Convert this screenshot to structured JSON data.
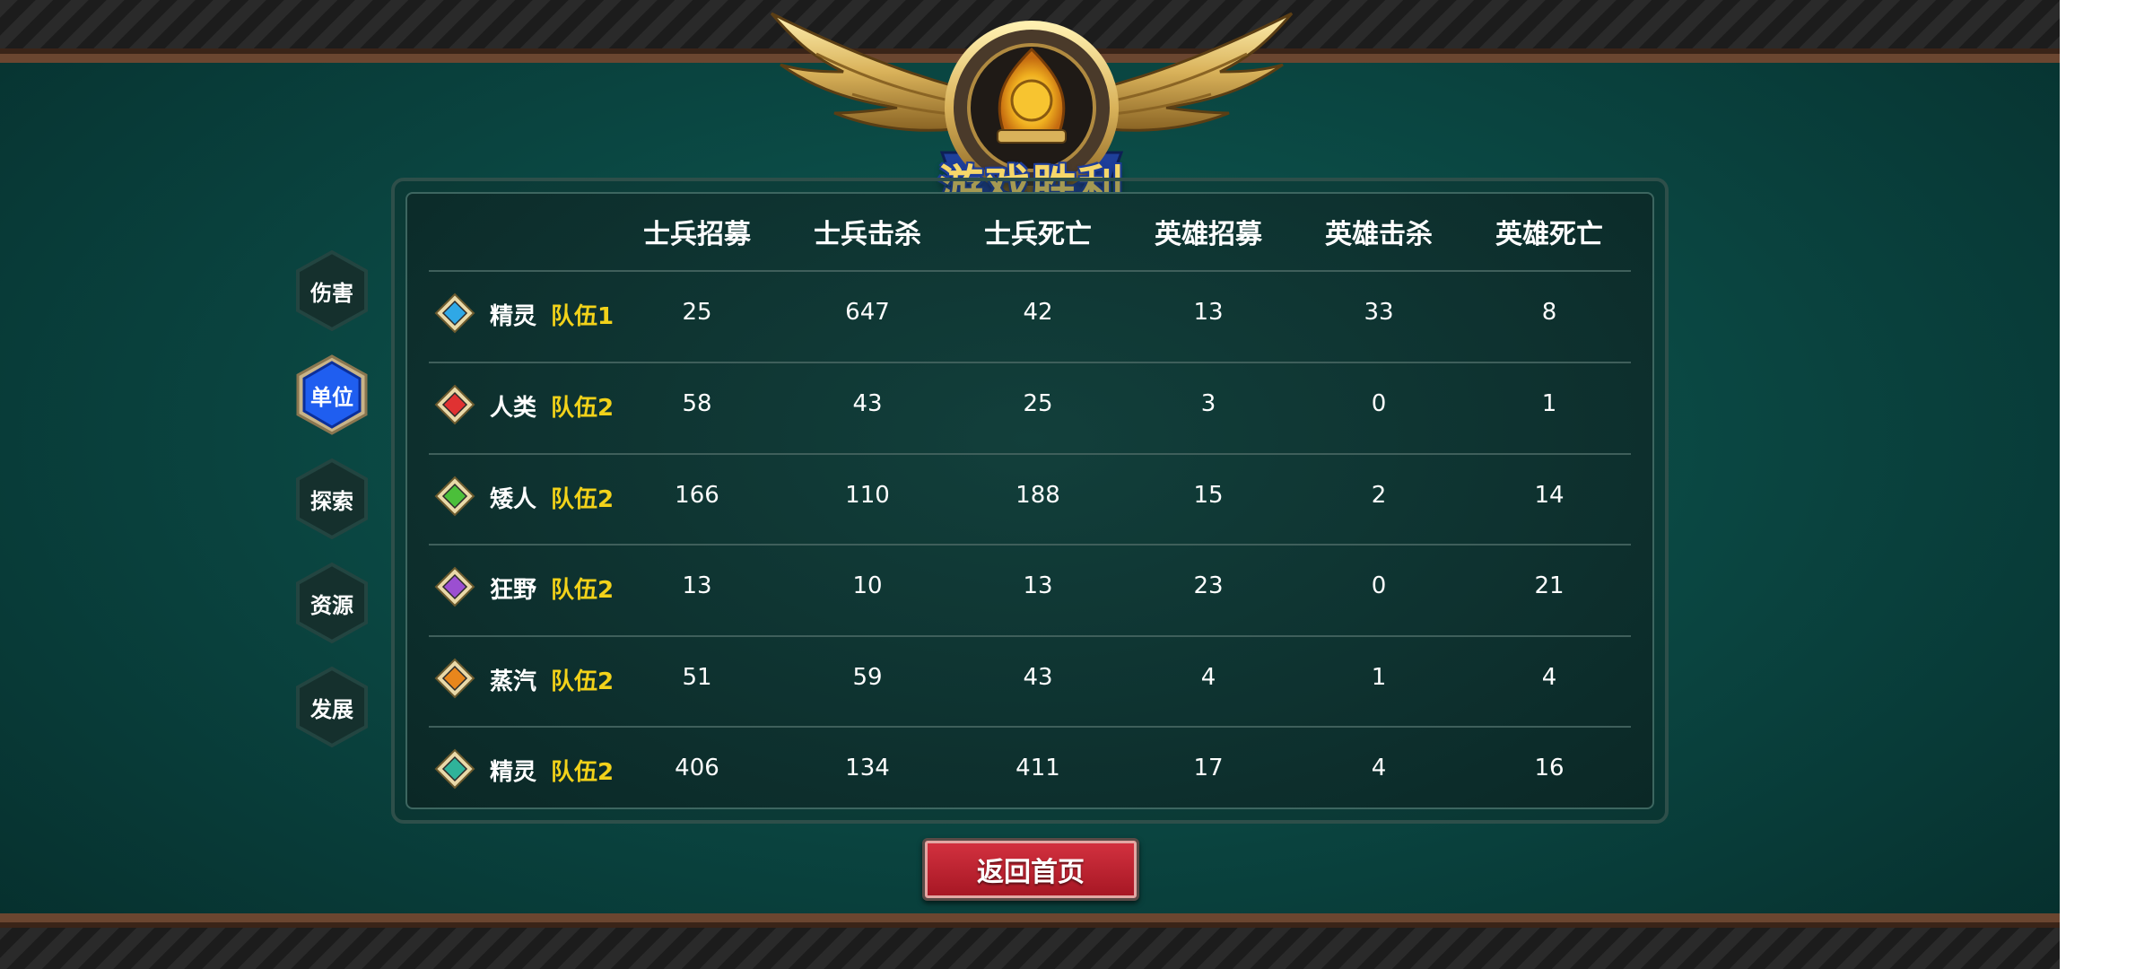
{
  "banner": {
    "title": "游戏胜利"
  },
  "tabs": [
    {
      "label": "伤害",
      "active": false
    },
    {
      "label": "单位",
      "active": true
    },
    {
      "label": "探索",
      "active": false
    },
    {
      "label": "资源",
      "active": false
    },
    {
      "label": "发展",
      "active": false
    }
  ],
  "table": {
    "headers": [
      "士兵招募",
      "士兵击杀",
      "士兵死亡",
      "英雄招募",
      "英雄击杀",
      "英雄死亡"
    ],
    "rows": [
      {
        "race": "精灵",
        "team": "队伍1",
        "gem_color": "#2fa8e6",
        "values": [
          "25",
          "647",
          "42",
          "13",
          "33",
          "8"
        ]
      },
      {
        "race": "人类",
        "team": "队伍2",
        "gem_color": "#e03232",
        "values": [
          "58",
          "43",
          "25",
          "3",
          "0",
          "1"
        ]
      },
      {
        "race": "矮人",
        "team": "队伍2",
        "gem_color": "#4bbf3a",
        "values": [
          "166",
          "110",
          "188",
          "15",
          "2",
          "14"
        ]
      },
      {
        "race": "狂野",
        "team": "队伍2",
        "gem_color": "#9b4fd1",
        "values": [
          "13",
          "10",
          "13",
          "23",
          "0",
          "21"
        ]
      },
      {
        "race": "蒸汽",
        "team": "队伍2",
        "gem_color": "#e8861c",
        "values": [
          "51",
          "59",
          "43",
          "4",
          "1",
          "4"
        ]
      },
      {
        "race": "精灵",
        "team": "队伍2",
        "gem_color": "#2fb39a",
        "values": [
          "406",
          "134",
          "411",
          "17",
          "4",
          "16"
        ]
      }
    ]
  },
  "buttons": {
    "return_home": "返回首页"
  },
  "colors": {
    "team_label": "#f2d21a",
    "active_tab": "#1f5ef0",
    "button": "#c21f2d"
  }
}
